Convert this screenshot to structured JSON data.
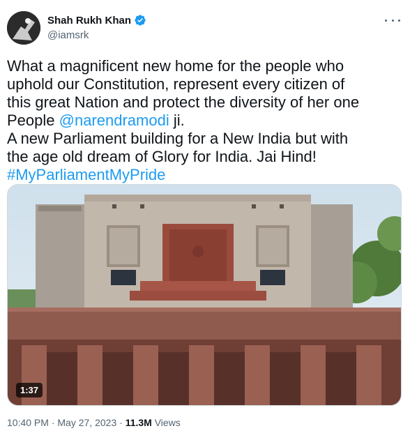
{
  "author": {
    "display_name": "Shah Rukh Khan",
    "handle": "@iamsrk",
    "verified": true,
    "avatar_icon": "user-avatar"
  },
  "more_icon": "more-horizontal-icon",
  "tweet": {
    "line1": "What a magnificent new home for the people who",
    "line2": "uphold our Constitution, represent every citizen of",
    "line3": "this great Nation and protect the diversity of her one",
    "line4_pre": "People ",
    "line4_mention": "@narendramodi",
    "line4_post": " ji.",
    "line5": "A new Parliament building for a New India but with",
    "line6": "the age old dream of Glory for India. Jai Hind!",
    "hashtag": "#MyParliamentMyPride"
  },
  "media": {
    "type": "video",
    "duration": "1:37"
  },
  "meta": {
    "time": "10:40 PM",
    "separator": " · ",
    "date": "May 27, 2023",
    "views_count": "11.3M",
    "views_label": " Views"
  },
  "colors": {
    "link": "#1d9bf0",
    "text": "#0f1419",
    "secondary": "#536471"
  }
}
